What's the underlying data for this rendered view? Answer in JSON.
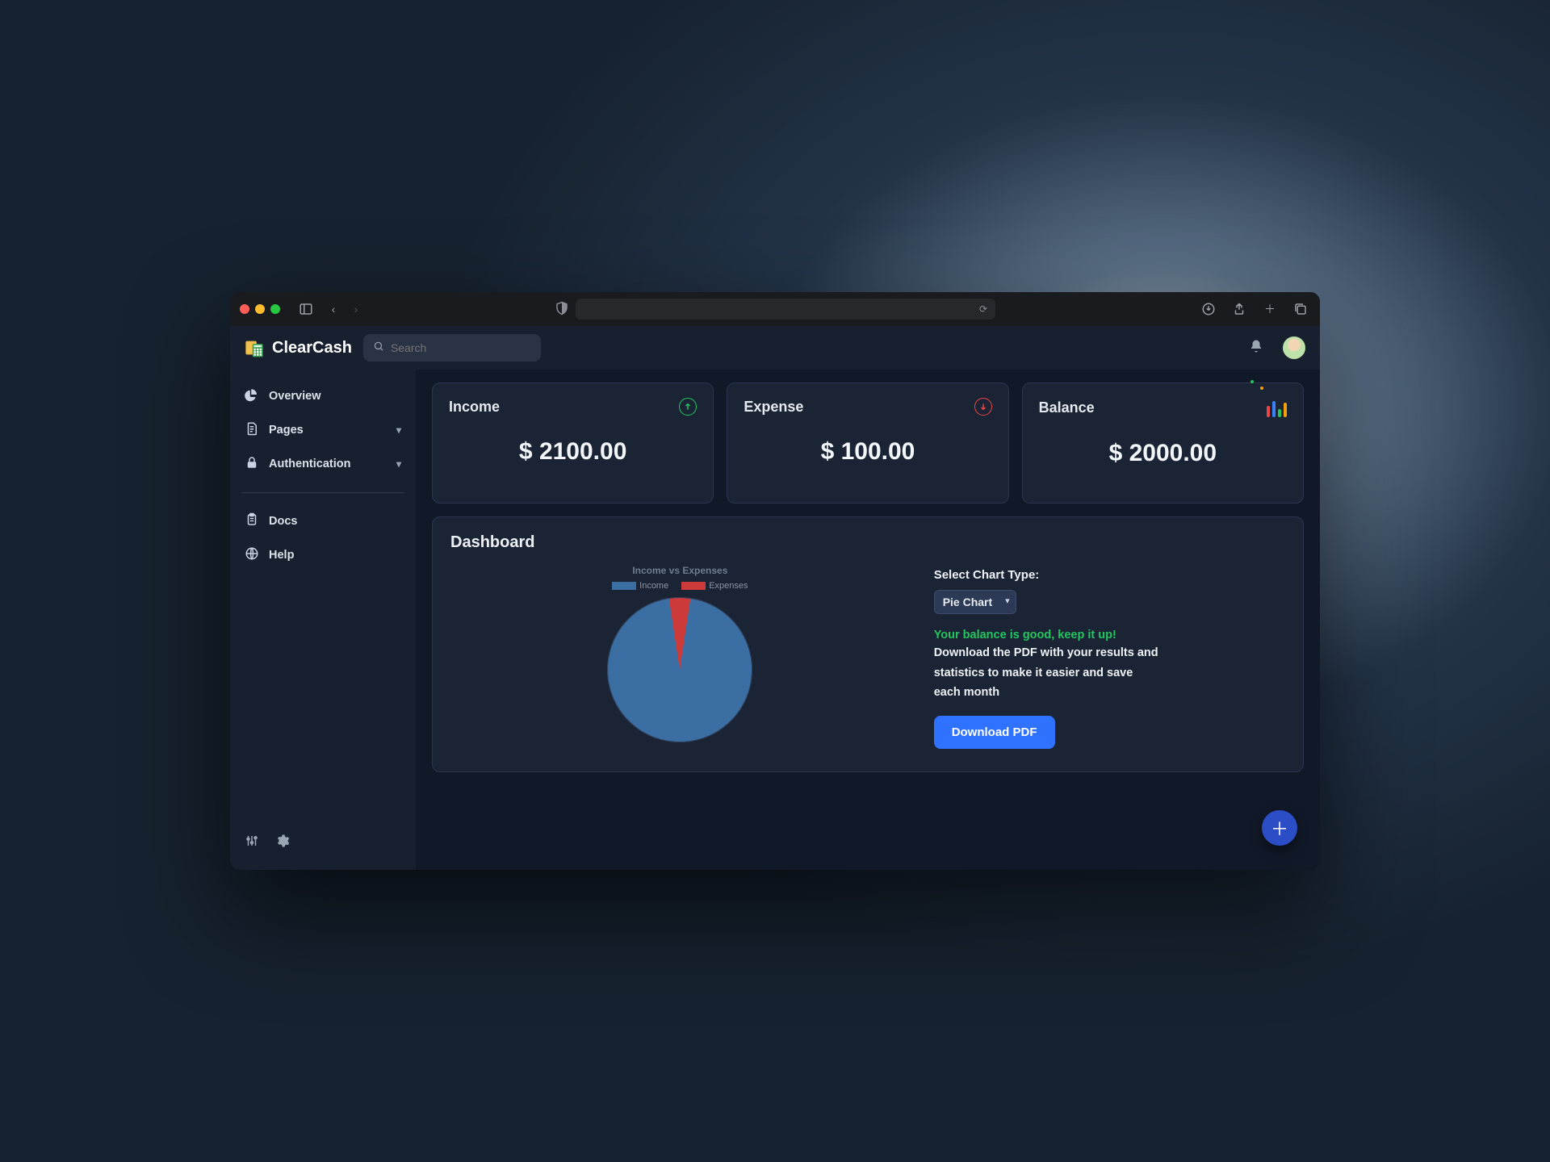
{
  "brand": {
    "name": "ClearCash"
  },
  "search": {
    "placeholder": "Search"
  },
  "sidebar": {
    "items": [
      {
        "label": "Overview",
        "icon": "pie-chart-icon",
        "expandable": false
      },
      {
        "label": "Pages",
        "icon": "document-icon",
        "expandable": true
      },
      {
        "label": "Authentication",
        "icon": "lock-icon",
        "expandable": true
      }
    ],
    "secondary": [
      {
        "label": "Docs",
        "icon": "clipboard-icon"
      },
      {
        "label": "Help",
        "icon": "globe-icon"
      }
    ]
  },
  "cards": {
    "income": {
      "title": "Income",
      "value": "$ 2100.00"
    },
    "expense": {
      "title": "Expense",
      "value": "$ 100.00"
    },
    "balance": {
      "title": "Balance",
      "value": "$ 2000.00"
    }
  },
  "dashboard": {
    "title": "Dashboard",
    "chart_select_label": "Select Chart Type:",
    "chart_select_value": "Pie Chart",
    "good_msg": "Your balance is good, keep it up!",
    "desc": "Download the PDF with your results and statistics to make it easier and save each month",
    "download_label": "Download PDF"
  },
  "chart_data": {
    "type": "pie",
    "title": "Income vs Expenses",
    "series": [
      {
        "name": "Income",
        "value": 2100,
        "color": "#3b6fa3"
      },
      {
        "name": "Expenses",
        "value": 100,
        "color": "#cc3a3a"
      }
    ]
  }
}
